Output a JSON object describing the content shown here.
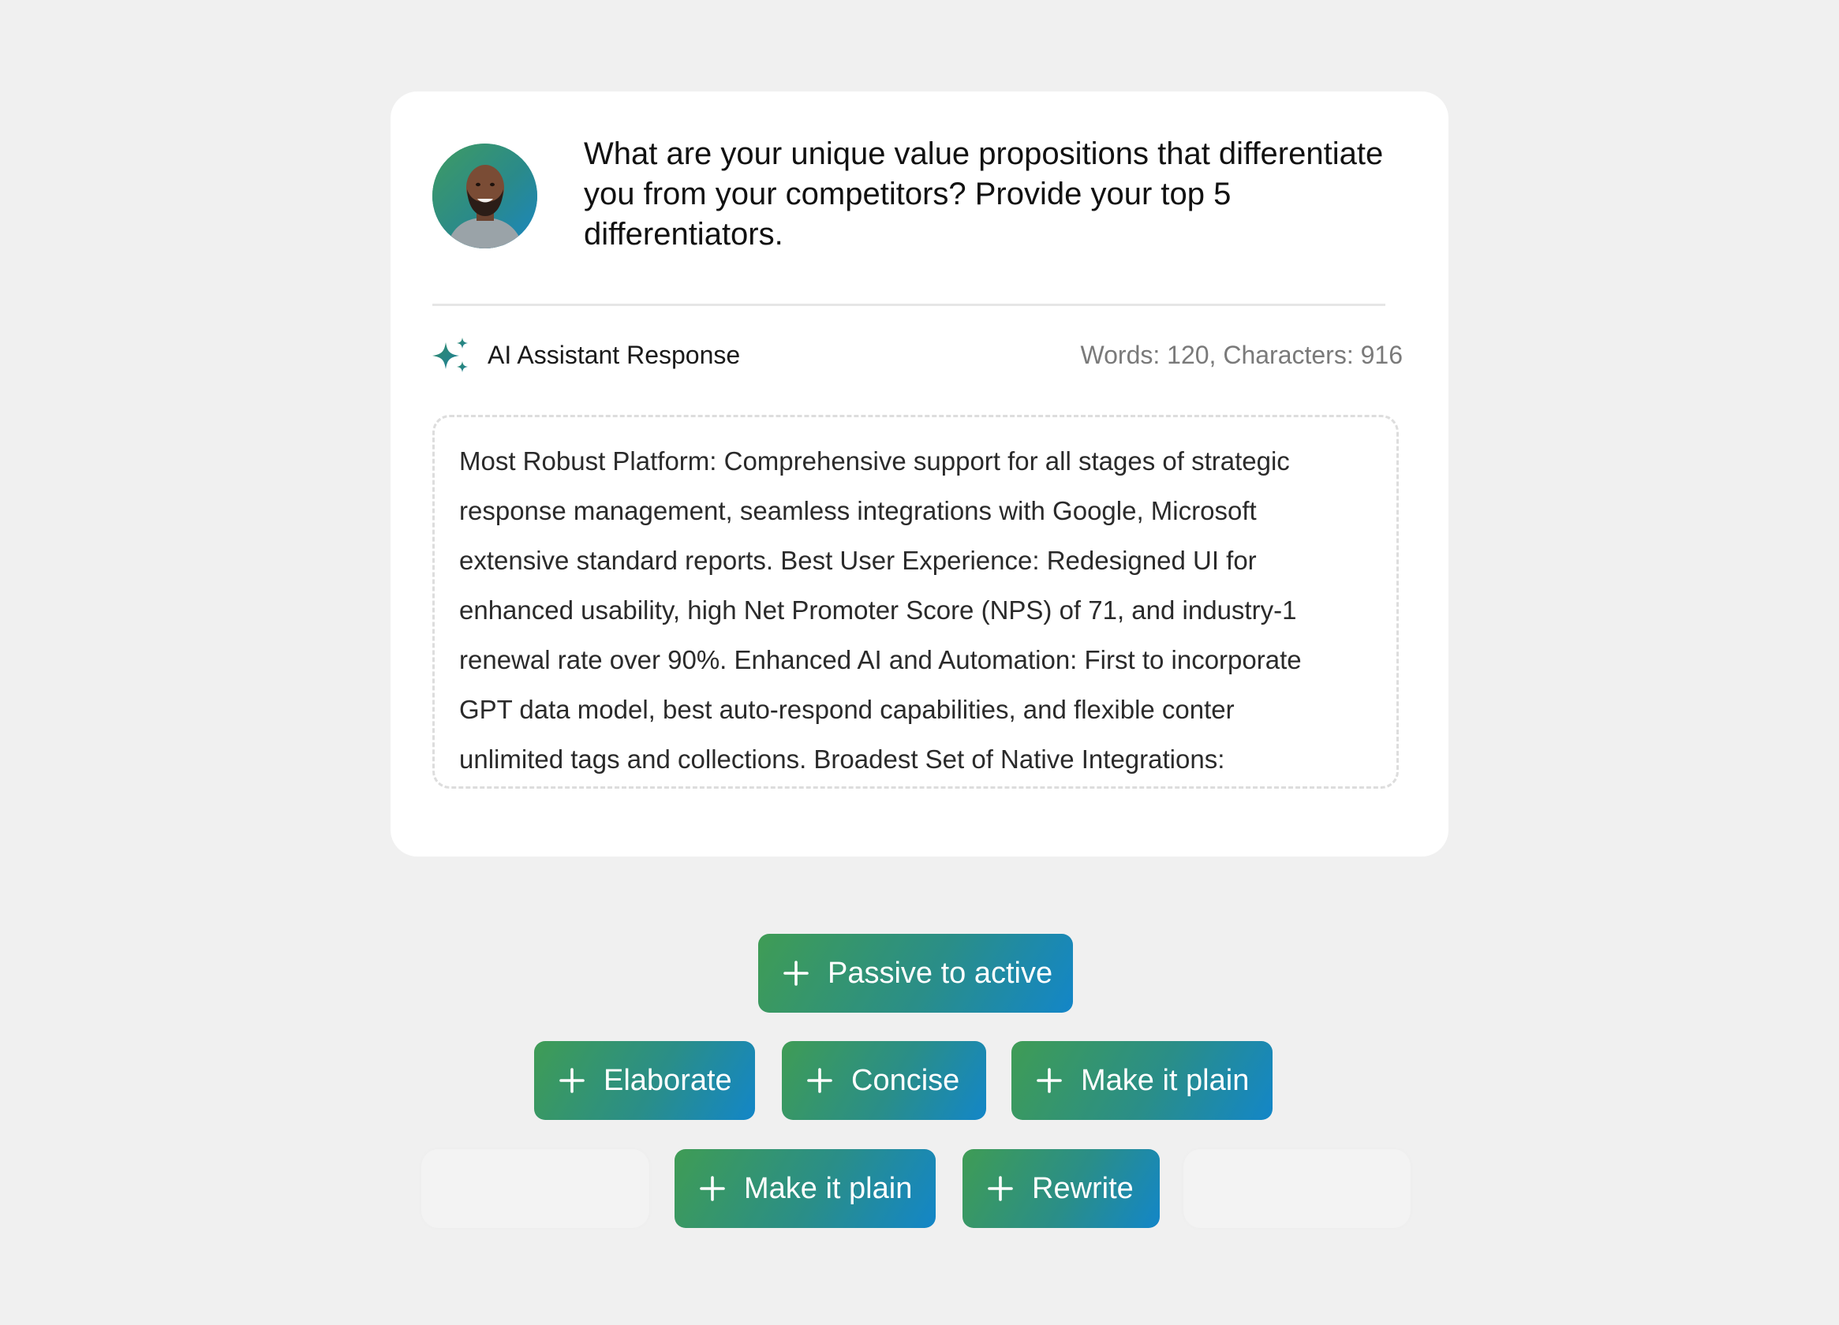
{
  "question": {
    "text": "What are your unique value propositions that differentiate you from your competitors? Provide your top 5 differentiators."
  },
  "response": {
    "title": "AI Assistant Response",
    "stats": "Words: 120, Characters: 916",
    "lines": [
      "Most Robust Platform: Comprehensive support for all stages of strategic",
      "response management, seamless integrations with Google, Microsoft",
      "extensive standard reports. Best User Experience: Redesigned UI for",
      "enhanced usability, high Net Promoter Score (NPS) of 71, and industry-1",
      "renewal rate over 90%. Enhanced AI and Automation: First to incorporate",
      "GPT data model, best auto-respond capabilities, and flexible conter",
      "unlimited tags and collections. Broadest Set of Native Integrations:"
    ]
  },
  "actions": {
    "passive_to_active": "Passive to active",
    "elaborate": "Elaborate",
    "concise": "Concise",
    "make_it_plain_1": "Make it plain",
    "make_it_plain_2": "Make it plain",
    "rewrite": "Rewrite"
  },
  "icons": {
    "avatar": "user-avatar",
    "sparkle": "sparkle-icon",
    "plus": "plus-icon"
  },
  "colors": {
    "accent_green": "#3f9c55",
    "accent_teal": "#2a8e88",
    "accent_blue": "#1386c8",
    "background": "#f0f0f0",
    "card": "#ffffff"
  }
}
